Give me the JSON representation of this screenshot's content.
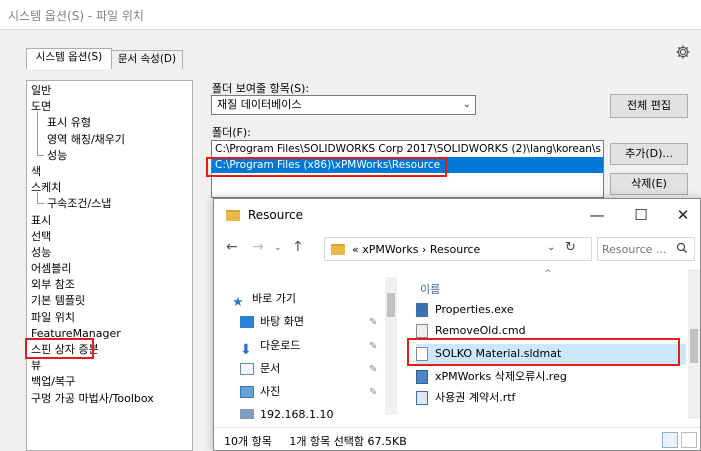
{
  "window": {
    "title": "시스템 옵션(S) - 파일 위치"
  },
  "tabs": [
    {
      "label": "시스템 옵션(S)"
    },
    {
      "label": "문서 속성(D)"
    }
  ],
  "tree": {
    "items": [
      {
        "label": "일반"
      },
      {
        "label": "도면"
      },
      {
        "label": "표시 유형"
      },
      {
        "label": "영역 해칭/채우기"
      },
      {
        "label": "성능"
      },
      {
        "label": "색"
      },
      {
        "label": "스케치"
      },
      {
        "label": "구속조건/스냅"
      },
      {
        "label": "표시"
      },
      {
        "label": "선택"
      },
      {
        "label": "성능"
      },
      {
        "label": "어셈블리"
      },
      {
        "label": "외부 참조"
      },
      {
        "label": "기본 템플릿"
      },
      {
        "label": "파일 위치"
      },
      {
        "label": "FeatureManager"
      },
      {
        "label": "스핀 상자 증분"
      },
      {
        "label": "뷰"
      },
      {
        "label": "백업/복구"
      },
      {
        "label": "구멍 가공 마법사/Toolbox"
      }
    ]
  },
  "settings": {
    "show_folders_for_label": "폴더 보여줄 항목(S):",
    "show_folders_for_value": "재질 데이터베이스",
    "folders_label": "폴더(F):",
    "folders": [
      "C:\\Program Files\\SOLIDWORKS Corp 2017\\SOLIDWORKS (2)\\lang\\korean\\s",
      "C:\\Program Files (x86)\\xPMWorks\\Resource"
    ],
    "edit_all_label": "전체 편집",
    "add_label": "추가(D)...",
    "delete_label": "삭제(E)"
  },
  "explorer": {
    "title": "Resource",
    "minimize": "—",
    "maximize": "☐",
    "close": "✕",
    "address_prefix": "«",
    "address_parts": [
      "xPMWorks",
      "›",
      "Resource"
    ],
    "search_placeholder": "Resource ...",
    "nav_items": [
      {
        "label": "바로 가기"
      },
      {
        "label": "바탕 화면"
      },
      {
        "label": "다운로드"
      },
      {
        "label": "문서"
      },
      {
        "label": "사진"
      },
      {
        "label": "192.168.1.10"
      }
    ],
    "column_header": "이름",
    "files": [
      {
        "name": "Properties.exe"
      },
      {
        "name": "RemoveOld.cmd"
      },
      {
        "name": "SOLKO Material.sldmat"
      },
      {
        "name": "xPMWorks 삭제오류시.reg"
      },
      {
        "name": "사용권 계약서.rtf"
      }
    ],
    "status": "10개 항목     1개 항목 선택함 67.5KB"
  },
  "colors": {
    "highlight_red": "#e31b1b",
    "selection_blue": "#0078d7",
    "file_selection": "#cce8ff"
  }
}
